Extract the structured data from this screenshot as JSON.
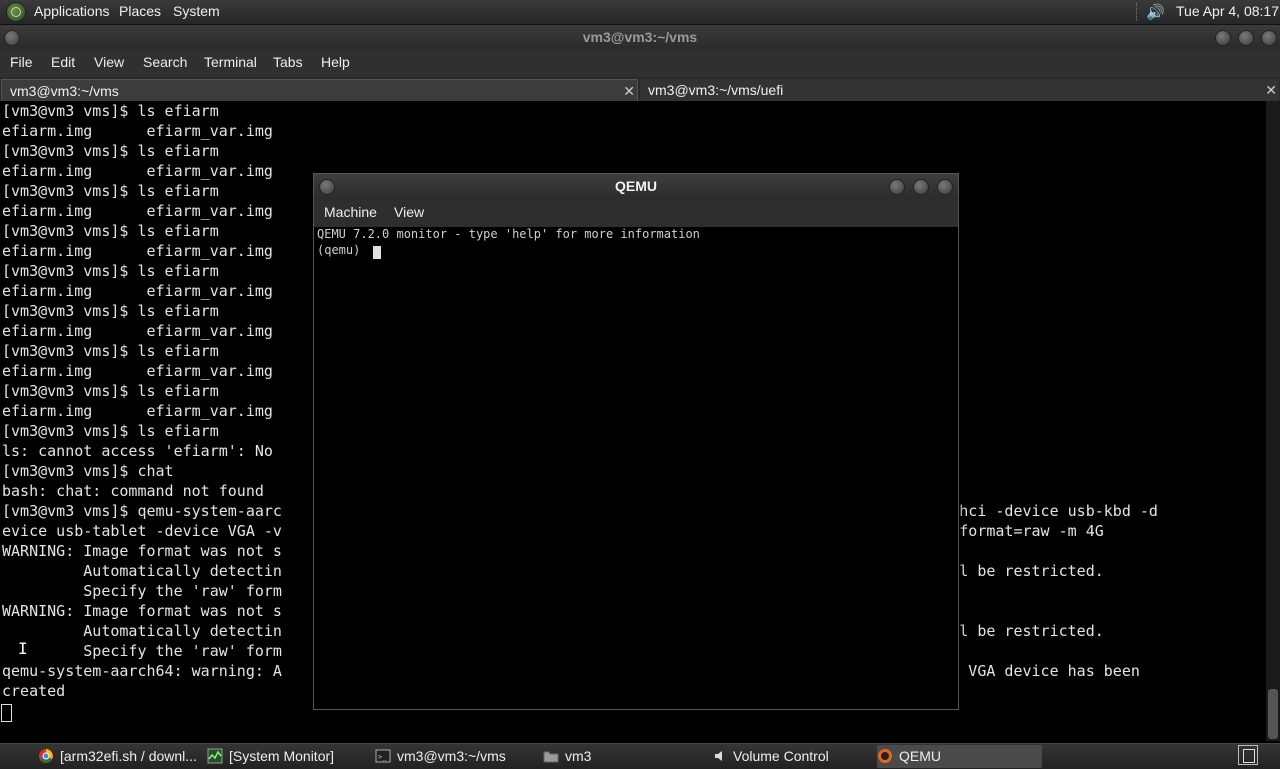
{
  "top_panel": {
    "menus": [
      "Applications",
      "Places",
      "System"
    ],
    "clock": "Tue Apr  4, 08:17",
    "volume_icon": "speaker-icon"
  },
  "terminal": {
    "title": "vm3@vm3:~/vms",
    "menus": [
      "File",
      "Edit",
      "View",
      "Search",
      "Terminal",
      "Tabs",
      "Help"
    ],
    "tabs": [
      {
        "label": "vm3@vm3:~/vms",
        "active": true
      },
      {
        "label": "vm3@vm3:~/vms/uefi",
        "active": false
      }
    ],
    "lines": [
      "[vm3@vm3 vms]$ ls efiarm",
      "efiarm.img      efiarm_var.img",
      "[vm3@vm3 vms]$ ls efiarm",
      "efiarm.img      efiarm_var.img",
      "[vm3@vm3 vms]$ ls efiarm",
      "efiarm.img      efiarm_var.img",
      "[vm3@vm3 vms]$ ls efiarm",
      "efiarm.img      efiarm_var.img",
      "[vm3@vm3 vms]$ ls efiarm",
      "efiarm.img      efiarm_var.img",
      "[vm3@vm3 vms]$ ls efiarm",
      "efiarm.img      efiarm_var.img",
      "[vm3@vm3 vms]$ ls efiarm",
      "efiarm.img      efiarm_var.img",
      "[vm3@vm3 vms]$ ls efiarm",
      "efiarm.img      efiarm_var.img",
      "[vm3@vm3 vms]$ ls efiarm",
      "ls: cannot access 'efiarm': No",
      "[vm3@vm3 vms]$ chat",
      "bash: chat: command not found",
      "[vm3@vm3 vms]$ qemu-system-aarc                                                                  hec-usb-xhci -device usb-kbd -d",
      "evice usb-tablet -device VGA -v                                                                  disk.img,format=raw -m 4G",
      "WARNING: Image format was not s",
      "         Automatically detectin                                                                  ock 0 will be restricted.",
      "         Specify the 'raw' form",
      "WARNING: Image format was not s",
      "         Automatically detectin                                                                  ock 0 will be restricted.",
      "         Specify the 'raw' form",
      "qemu-system-aarch64: warning: A                                                                  ption; No VGA device has been",
      "created"
    ]
  },
  "qemu": {
    "title": "QEMU",
    "menus": [
      "Machine",
      "View"
    ],
    "console_lines": [
      "QEMU 7.2.0 monitor - type 'help' for more information",
      "(qemu) "
    ]
  },
  "taskbar": {
    "items": [
      {
        "label": "[arm32efi.sh / downl...",
        "icon": "browser-icon"
      },
      {
        "label": "[System Monitor]",
        "icon": "system-monitor-icon"
      },
      {
        "label": "vm3@vm3:~/vms",
        "icon": "terminal-icon"
      },
      {
        "label": "vm3",
        "icon": "folder-icon"
      },
      {
        "label": "Volume Control",
        "icon": "volume-control-icon"
      },
      {
        "label": "QEMU",
        "icon": "qemu-icon"
      }
    ]
  }
}
